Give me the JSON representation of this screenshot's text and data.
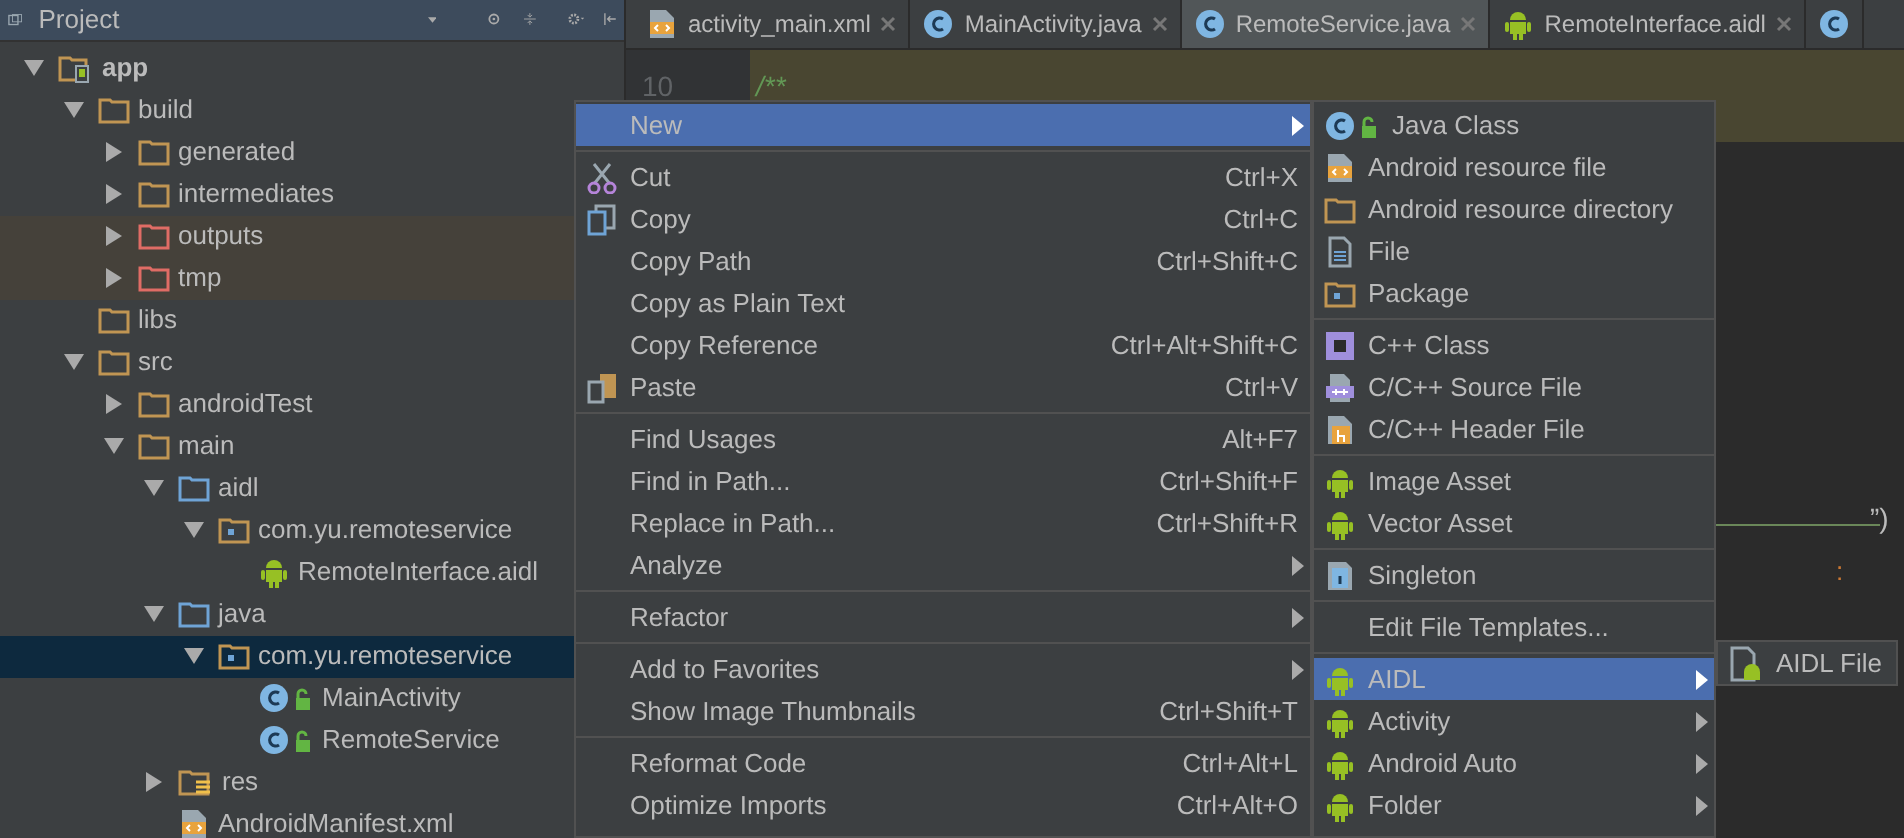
{
  "project_panel": {
    "title": "Project"
  },
  "tree": [
    {
      "label": "app",
      "kind": "module",
      "expanded": true,
      "selected": false,
      "children": [
        {
          "label": "build",
          "kind": "folder",
          "expanded": true,
          "selected": false,
          "children": [
            {
              "label": "generated",
              "kind": "folder",
              "expanded": false,
              "selected": false
            },
            {
              "label": "intermediates",
              "kind": "folder",
              "expanded": false,
              "selected": false
            },
            {
              "label": "outputs",
              "kind": "excluded-folder",
              "expanded": false,
              "selected": false
            },
            {
              "label": "tmp",
              "kind": "excluded-folder",
              "expanded": false,
              "selected": false
            }
          ]
        },
        {
          "label": "libs",
          "kind": "folder",
          "selected": false
        },
        {
          "label": "src",
          "kind": "folder",
          "expanded": true,
          "selected": false,
          "children": [
            {
              "label": "androidTest",
              "kind": "folder",
              "expanded": false,
              "selected": false
            },
            {
              "label": "main",
              "kind": "folder",
              "expanded": true,
              "selected": false,
              "children": [
                {
                  "label": "aidl",
                  "kind": "source-folder",
                  "expanded": true,
                  "selected": false,
                  "children": [
                    {
                      "label": "com.yu.remoteservice",
                      "kind": "package",
                      "expanded": true,
                      "selected": false,
                      "children": [
                        {
                          "label": "RemoteInterface.aidl",
                          "kind": "android",
                          "selected": false
                        }
                      ]
                    }
                  ]
                },
                {
                  "label": "java",
                  "kind": "source-folder",
                  "expanded": true,
                  "selected": false,
                  "children": [
                    {
                      "label": "com.yu.remoteservice",
                      "kind": "package",
                      "expanded": true,
                      "selected": true,
                      "children": [
                        {
                          "label": "MainActivity",
                          "kind": "class",
                          "selected": false
                        },
                        {
                          "label": "RemoteService",
                          "kind": "class",
                          "selected": false
                        }
                      ]
                    }
                  ]
                },
                {
                  "label": "res",
                  "kind": "res",
                  "expanded": false,
                  "selected": false
                },
                {
                  "label": "AndroidManifest.xml",
                  "kind": "xml",
                  "selected": false
                }
              ]
            }
          ]
        }
      ]
    }
  ],
  "tabs": [
    {
      "label": "activity_main.xml",
      "kind": "xml",
      "selected": false
    },
    {
      "label": "MainActivity.java",
      "kind": "class",
      "selected": false
    },
    {
      "label": "RemoteService.java",
      "kind": "class",
      "selected": true
    },
    {
      "label": "RemoteInterface.aidl",
      "kind": "android",
      "selected": false
    },
    {
      "kind": "class",
      "selected": false
    }
  ],
  "editor": {
    "line_number": "10",
    "comment": "/**",
    "fragment_1": "”)",
    "fragment_2": ":"
  },
  "context_menu": {
    "groups": [
      [
        {
          "label": "New",
          "kind": "none",
          "submenu": true,
          "selected": true
        }
      ],
      [
        {
          "label": "Cut",
          "kind": "cut",
          "shortcut": "Ctrl+X",
          "selected": false
        },
        {
          "label": "Copy",
          "kind": "copy",
          "shortcut": "Ctrl+C",
          "selected": false
        },
        {
          "label": "Copy Path",
          "kind": "none",
          "shortcut": "Ctrl+Shift+C",
          "selected": false
        },
        {
          "label": "Copy as Plain Text",
          "kind": "none",
          "selected": false
        },
        {
          "label": "Copy Reference",
          "kind": "none",
          "shortcut": "Ctrl+Alt+Shift+C",
          "selected": false
        },
        {
          "label": "Paste",
          "kind": "paste",
          "shortcut": "Ctrl+V",
          "selected": false
        }
      ],
      [
        {
          "label": "Find Usages",
          "kind": "none",
          "shortcut": "Alt+F7",
          "selected": false
        },
        {
          "label": "Find in Path...",
          "kind": "none",
          "shortcut": "Ctrl+Shift+F",
          "selected": false
        },
        {
          "label": "Replace in Path...",
          "kind": "none",
          "shortcut": "Ctrl+Shift+R",
          "selected": false
        },
        {
          "label": "Analyze",
          "kind": "none",
          "submenu": true,
          "selected": false
        }
      ],
      [
        {
          "label": "Refactor",
          "kind": "none",
          "submenu": true,
          "selected": false
        }
      ],
      [
        {
          "label": "Add to Favorites",
          "kind": "none",
          "submenu": true,
          "selected": false
        },
        {
          "label": "Show Image Thumbnails",
          "kind": "none",
          "shortcut": "Ctrl+Shift+T",
          "selected": false
        }
      ],
      [
        {
          "label": "Reformat Code",
          "kind": "none",
          "shortcut": "Ctrl+Alt+L",
          "selected": false
        },
        {
          "label": "Optimize Imports",
          "kind": "none",
          "shortcut": "Ctrl+Alt+O",
          "selected": false
        }
      ]
    ]
  },
  "new_submenu": {
    "groups": [
      [
        {
          "label": "Java Class",
          "kind": "class",
          "selected": false
        },
        {
          "label": "Android resource file",
          "kind": "xml",
          "selected": false
        },
        {
          "label": "Android resource directory",
          "kind": "folder",
          "selected": false
        },
        {
          "label": "File",
          "kind": "file",
          "selected": false
        },
        {
          "label": "Package",
          "kind": "package",
          "selected": false
        }
      ],
      [
        {
          "label": "C++ Class",
          "kind": "cpp-class",
          "selected": false
        },
        {
          "label": "C/C++ Source File",
          "kind": "cpp-source",
          "selected": false
        },
        {
          "label": "C/C++ Header File",
          "kind": "cpp-header",
          "selected": false
        }
      ],
      [
        {
          "label": "Image Asset",
          "kind": "android",
          "selected": false
        },
        {
          "label": "Vector Asset",
          "kind": "android",
          "selected": false
        }
      ],
      [
        {
          "label": "Singleton",
          "kind": "singleton",
          "selected": false
        }
      ],
      [
        {
          "label": "Edit File Templates...",
          "kind": "none",
          "selected": false
        }
      ],
      [
        {
          "label": "AIDL",
          "kind": "android",
          "submenu": true,
          "selected": true
        },
        {
          "label": "Activity",
          "kind": "android",
          "submenu": true,
          "selected": false
        },
        {
          "label": "Android Auto",
          "kind": "android",
          "submenu": true,
          "selected": false
        },
        {
          "label": "Folder",
          "kind": "android",
          "submenu": true,
          "selected": false
        }
      ]
    ]
  },
  "aidl_submenu": {
    "items": [
      {
        "label": "AIDL File",
        "kind": "aidl-file",
        "selected": false
      }
    ]
  }
}
